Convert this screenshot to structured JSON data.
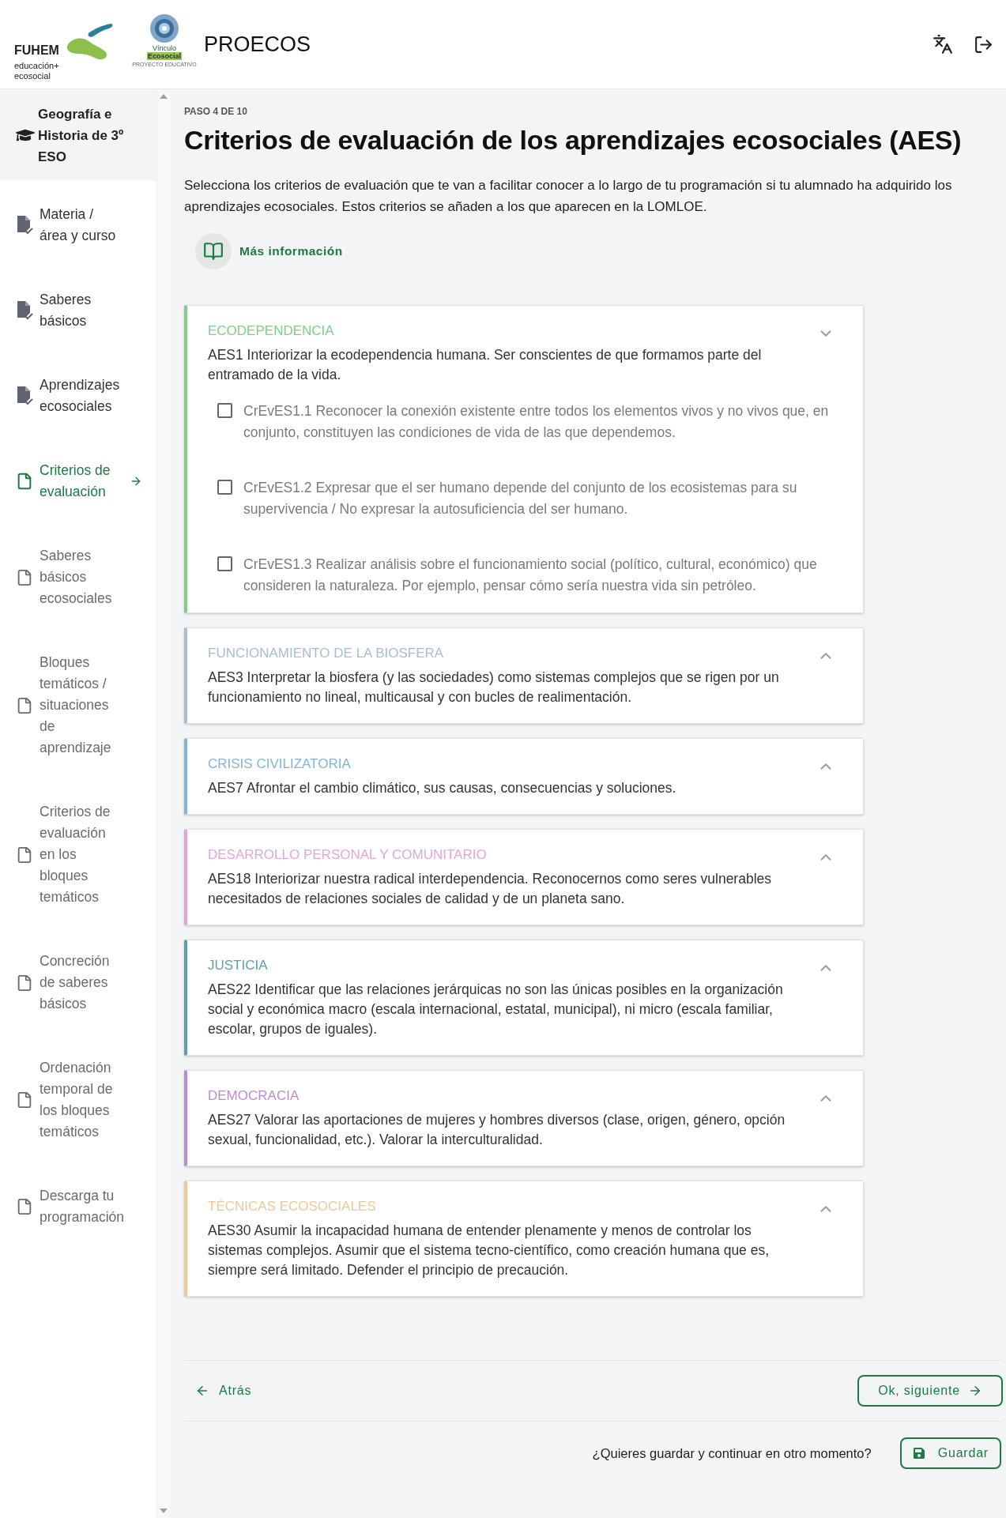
{
  "header": {
    "logo_fuhem": {
      "name": "FUHEM",
      "tagline_1": "educación+",
      "tagline_2": "ecosocial"
    },
    "logo_vinculo": {
      "line_1": "Vínculo",
      "line_2": "Ecosocial",
      "line_3": "PROYECTO EDUCATIVO"
    },
    "app_title": "PROECOS"
  },
  "sidebar": {
    "course": "Geografía e Historia de 3º ESO",
    "items": [
      {
        "label": "Materia / área y curso",
        "kind": "done",
        "selected": false
      },
      {
        "label": "Saberes básicos",
        "kind": "done",
        "selected": false
      },
      {
        "label": "Aprendizajes ecosociales",
        "kind": "done",
        "selected": false
      },
      {
        "label": "Criterios de evaluación",
        "kind": "todo",
        "selected": true
      },
      {
        "label": "Saberes básicos ecosociales",
        "kind": "todo",
        "selected": false
      },
      {
        "label": "Bloques temáticos / situaciones de aprendizaje",
        "kind": "todo",
        "selected": false
      },
      {
        "label": "Criterios de evaluación en los bloques temáticos",
        "kind": "todo",
        "selected": false
      },
      {
        "label": "Concreción de saberes básicos",
        "kind": "todo",
        "selected": false
      },
      {
        "label": "Ordenación temporal de los bloques temáticos",
        "kind": "todo",
        "selected": false
      },
      {
        "label": "Descarga tu programación",
        "kind": "todo",
        "selected": false
      }
    ]
  },
  "main": {
    "step": "PASO 4 DE 10",
    "title": "Criterios de evaluación de los aprendizajes ecosociales (AES)",
    "intro": "Selecciona los criterios de evaluación que te van a facilitar conocer a lo largo de tu programación si tu alumnado ha adquirido los aprendizajes ecosociales. Estos criterios se añaden a los que aparecen en la LOMLOE.",
    "more_info": "Más información",
    "groups": [
      {
        "title": "ECODEPENDENCIA",
        "color": "#84cc88",
        "expanded": true,
        "description": "AES1 Interiorizar la ecodependencia humana. Ser conscientes de que formamos parte del entramado de la vida.",
        "criteria": [
          {
            "text": "CrEvES1.1 Reconocer la conexión existente entre todos los elementos vivos y no vivos que, en conjunto, constituyen las condiciones de vida de las que dependemos.",
            "checked": false
          },
          {
            "text": "CrEvES1.2 Expresar que el ser humano depende del conjunto de los ecosistemas para su supervivencia / No expresar la autosuficiencia del ser humano.",
            "checked": false
          },
          {
            "text": "CrEvES1.3 Realizar análisis sobre el funcionamiento social (político, cultural, económico) que consideren la naturaleza. Por ejemplo, pensar cómo sería nuestra vida sin petróleo.",
            "checked": false
          }
        ]
      },
      {
        "title": "FUNCIONAMIENTO DE LA BIOSFERA",
        "color": "#a7bfca",
        "expanded": false,
        "description": "AES3 Interpretar la biosfera (y las sociedades) como sistemas complejos que se rigen por un funcionamiento no lineal, multicausal y con bucles de realimentación."
      },
      {
        "title": "CRISIS CIVILIZATORIA",
        "color": "#7fb6d6",
        "expanded": false,
        "description": "AES7 Afrontar el cambio climático, sus causas, consecuencias y soluciones."
      },
      {
        "title": "DESARROLLO PERSONAL Y COMUNITARIO",
        "color": "#e0a6dc",
        "expanded": false,
        "description": "AES18 Interiorizar nuestra radical interdependencia. Reconocernos como seres vulnerables necesitados de relaciones sociales de calidad y de un planeta sano."
      },
      {
        "title": "JUSTICIA",
        "color": "#5b9fb1",
        "expanded": false,
        "description": "AES22 Identificar que las relaciones jerárquicas no son las únicas posibles en la organización social y económica macro (escala internacional, estatal, municipal), ni micro (escala familiar, escolar, grupos de iguales)."
      },
      {
        "title": "DEMOCRACIA",
        "color": "#b98dcf",
        "expanded": false,
        "description": "AES27 Valorar las aportaciones de mujeres y hombres diversos (clase, origen, género, opción sexual, funcionalidad, etc.). Valorar la interculturalidad."
      },
      {
        "title": "TÉCNICAS ECOSOCIALES",
        "color": "#efc894",
        "expanded": false,
        "description": "AES30 Asumir la incapacidad humana de entender plenamente y menos de controlar los sistemas complejos. Asumir que el sistema tecno-científico, como creación humana que es, siempre será limitado. Defender el principio de precaución."
      }
    ]
  },
  "footer": {
    "back": "Atrás",
    "next": "Ok, siguiente",
    "save_prompt": "¿Quieres guardar y continuar en otro momento?",
    "save": "Guardar"
  }
}
